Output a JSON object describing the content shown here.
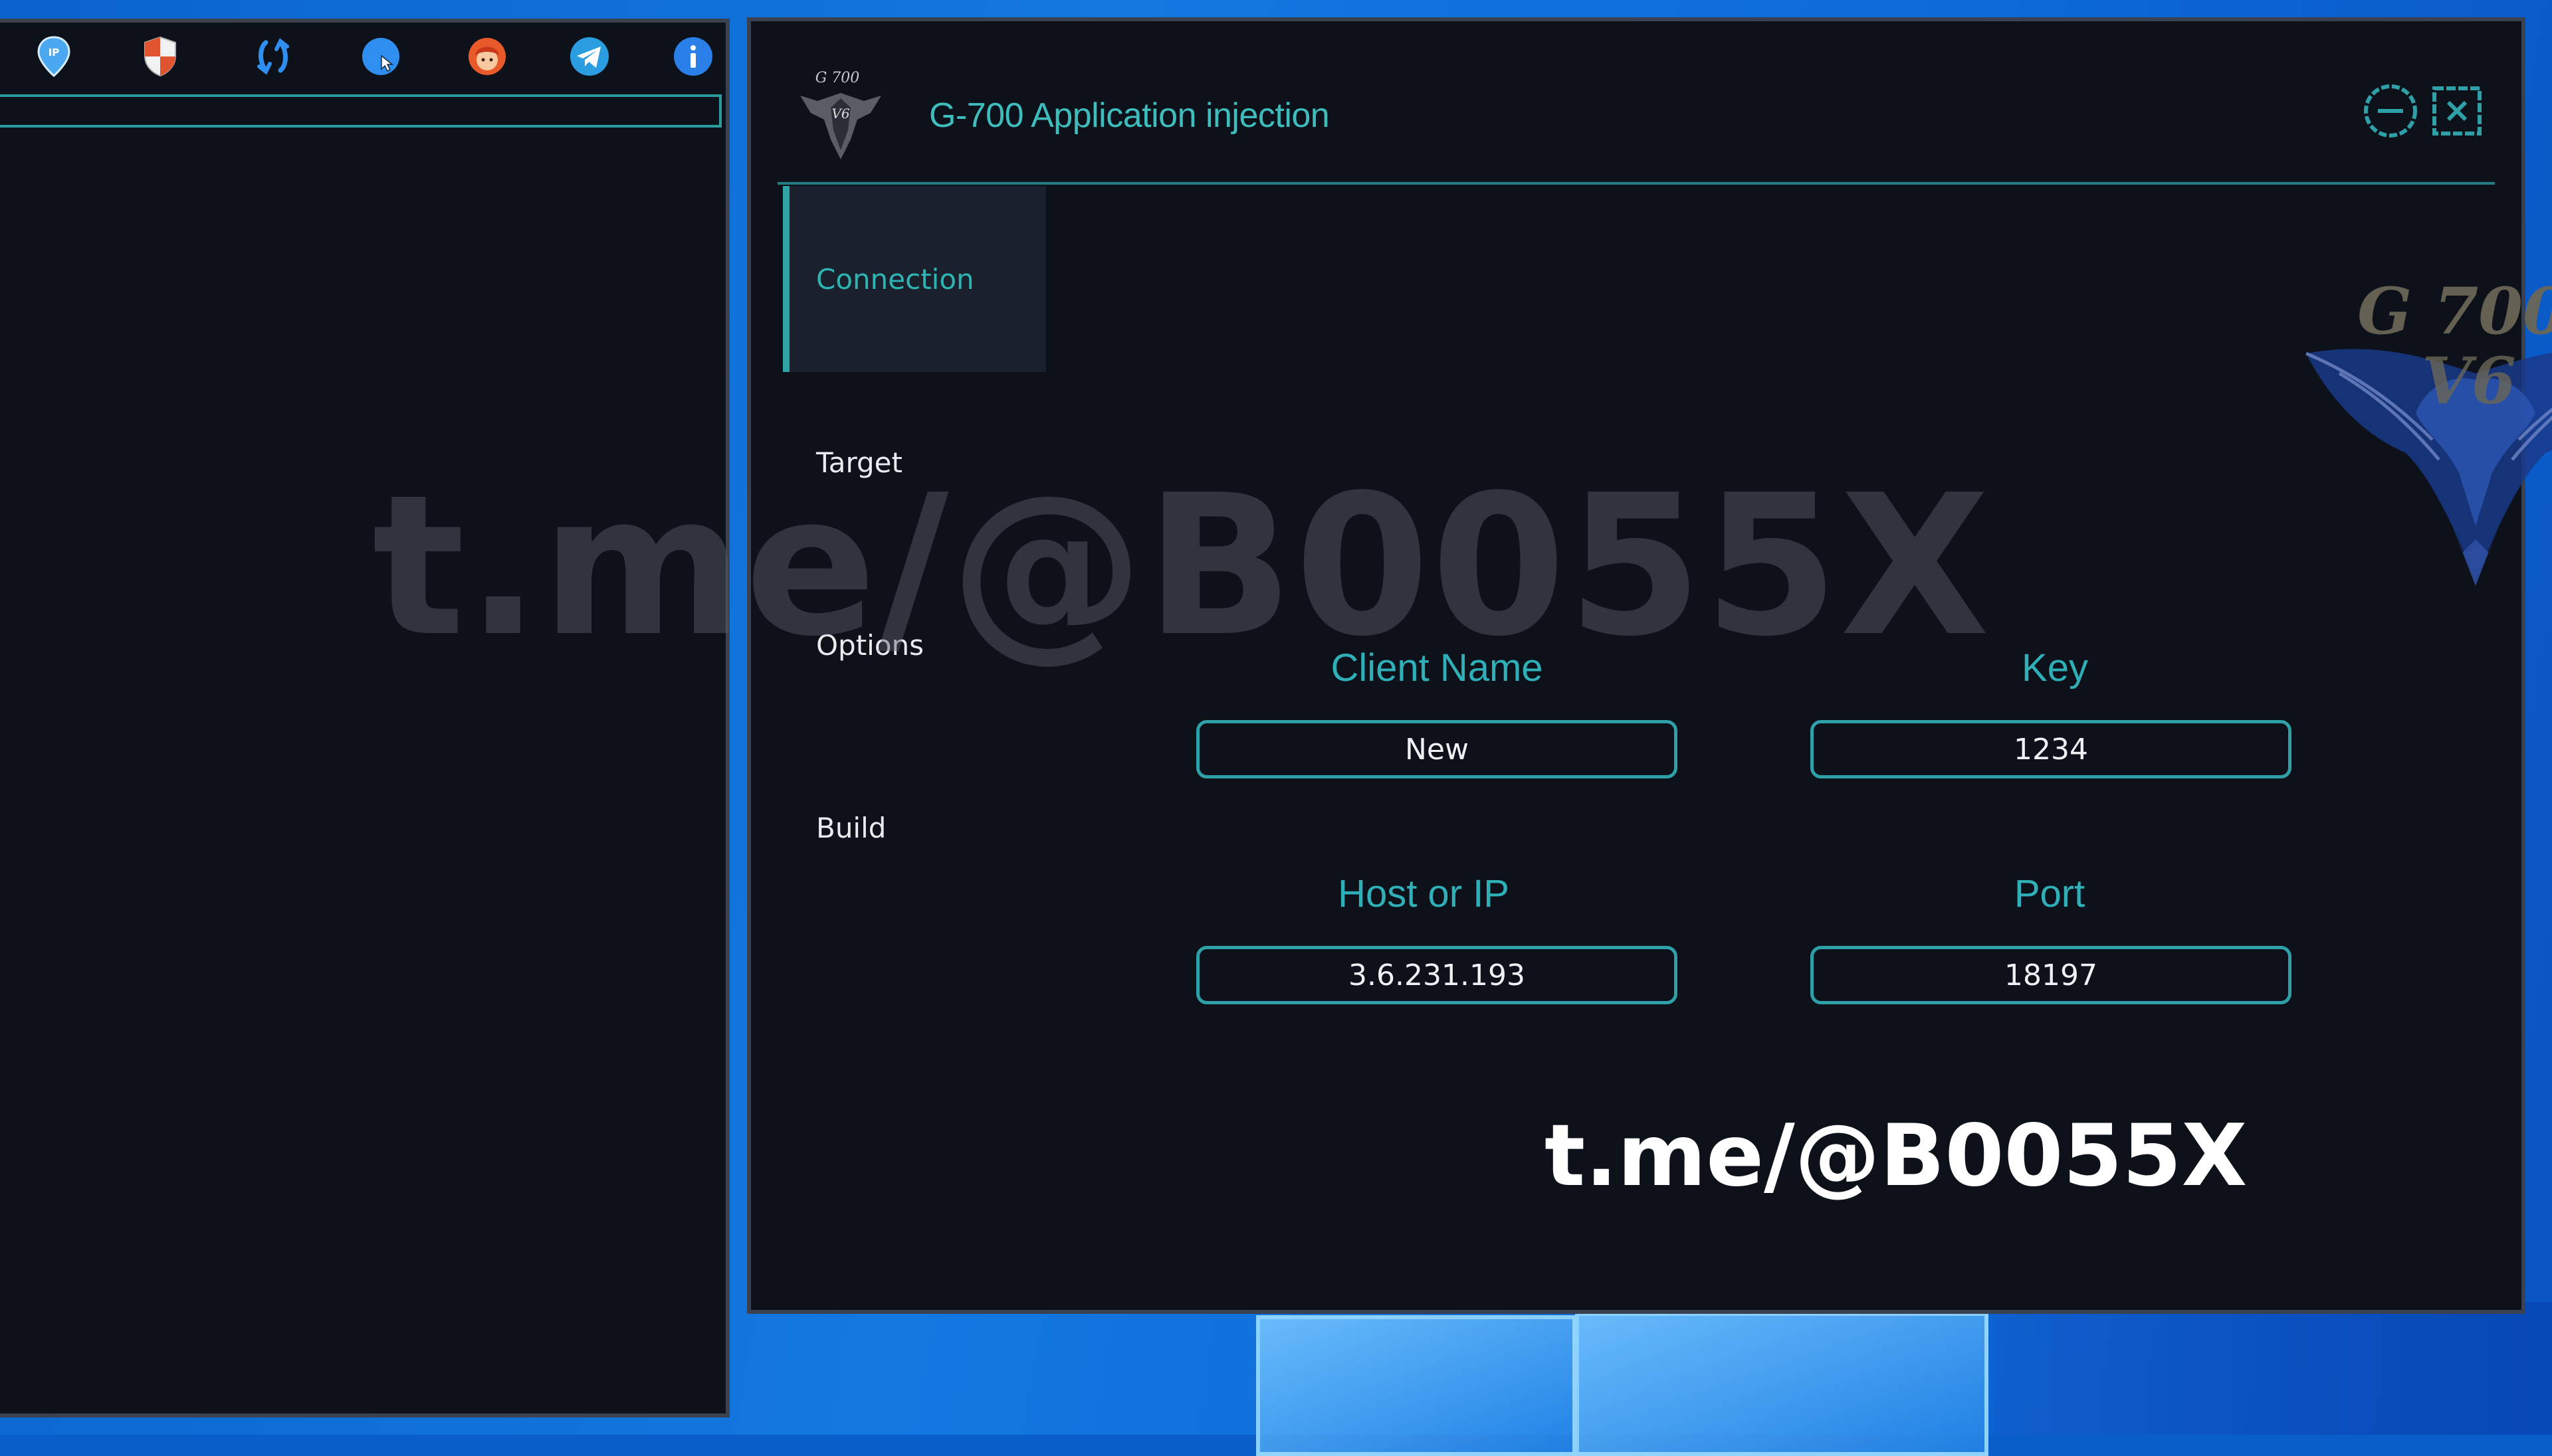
{
  "app": {
    "title": "G-700 Application injection"
  },
  "nav": {
    "items": [
      {
        "label": "Connection",
        "active": true
      },
      {
        "label": "Target",
        "active": false
      },
      {
        "label": "Options",
        "active": false
      },
      {
        "label": "Build",
        "active": false
      }
    ]
  },
  "form": {
    "client_name": {
      "label": "Client Name",
      "value": "New"
    },
    "key": {
      "label": "Key",
      "value": "1234"
    },
    "host": {
      "label": "Host or IP",
      "value": "3.6.231.193"
    },
    "port": {
      "label": "Port",
      "value": "18197"
    }
  },
  "watermark": {
    "large": "t.me/@B0055X",
    "small": "t.me/@B0055X"
  },
  "toolbar": {
    "icons": [
      "ip-pin-icon",
      "shield-icon",
      "refresh-icon",
      "cursor-globe-icon",
      "user-avatar-icon",
      "telegram-icon",
      "info-icon"
    ]
  },
  "colors": {
    "accent": "#2fb0b8",
    "window_bg": "#0d1119",
    "nav_active_bg": "#1b202d",
    "desktop": "#0b63cf"
  }
}
